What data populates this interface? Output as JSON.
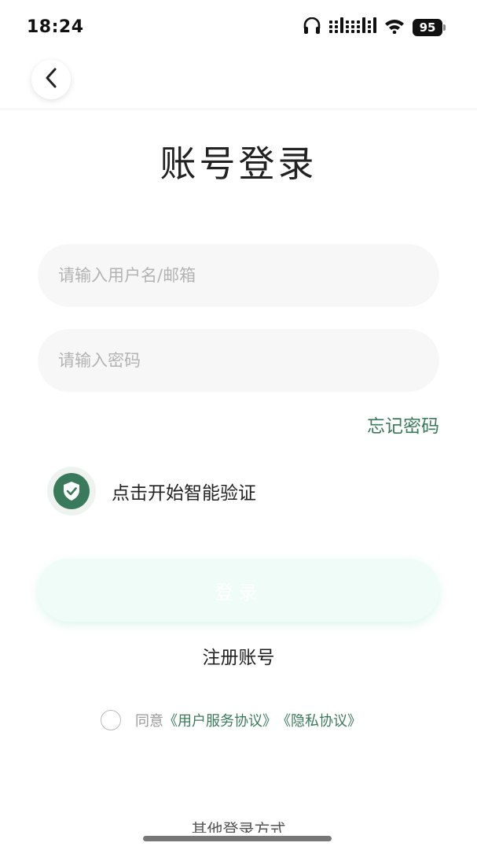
{
  "status_bar": {
    "time": "18:24",
    "battery": "95",
    "icons": [
      "headphones-icon",
      "signal-icon",
      "wifi-icon",
      "battery-icon"
    ]
  },
  "nav": {
    "back_icon": "chevron-left-icon"
  },
  "page": {
    "title": "账号登录"
  },
  "form": {
    "username_placeholder": "请输入用户名/邮箱",
    "username_value": "",
    "password_placeholder": "请输入密码",
    "password_value": "",
    "forgot_password": "忘记密码",
    "verify_label": "点击开始智能验证",
    "verify_icon": "shield-check-icon",
    "login_label": "登录",
    "register_label": "注册账号"
  },
  "agreement": {
    "prefix": "同意",
    "user_agreement": "《用户服务协议》",
    "privacy_policy": "《隐私协议》",
    "checked": false
  },
  "other_login": {
    "label": "其他登录方式"
  },
  "colors": {
    "accent": "#3a7a5c",
    "login_button_bg": "#effcf7",
    "input_bg": "#f7f7f7",
    "placeholder": "#b3b3b3"
  }
}
